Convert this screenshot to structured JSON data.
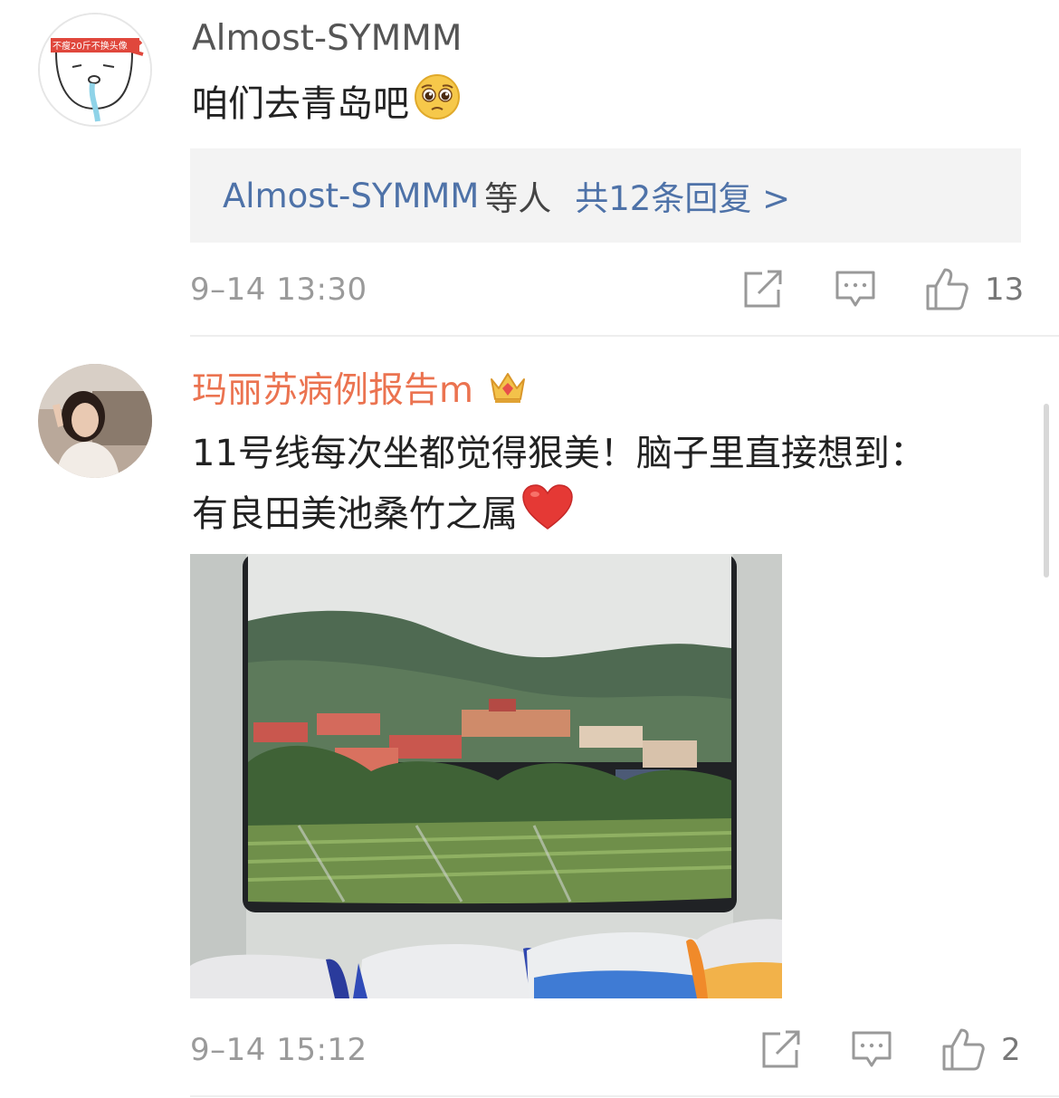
{
  "comments": [
    {
      "username": "Almost-SYMMM",
      "avatar_banner_text": "不瘦20斤不换头像",
      "text": "咱们去青岛吧",
      "emoji": "pleading-face",
      "reply_preview": {
        "user": "Almost-SYMMM",
        "others": "等人",
        "count_label": "共12条回复 >"
      },
      "timestamp": "9–14 13:30",
      "likes": "13"
    },
    {
      "username": "玛丽苏病例报告m",
      "badge": "crown-badge",
      "text_line1": "11号线每次坐都觉得狠美！脑子里直接想到：",
      "text_line2": "有良田美池桑竹之属",
      "emoji": "red-heart",
      "photo": "train-window-view-of-village-and-hills",
      "timestamp": "9–14 15:12",
      "likes": "2"
    }
  ],
  "icons": {
    "share": "share-icon",
    "comment": "comment-icon",
    "like": "thumbs-up-icon"
  },
  "colors": {
    "username_vip": "#eb7350",
    "link_blue": "#4e72a8",
    "meta_gray": "#9a9a9a",
    "reply_bg": "#f3f3f3"
  }
}
